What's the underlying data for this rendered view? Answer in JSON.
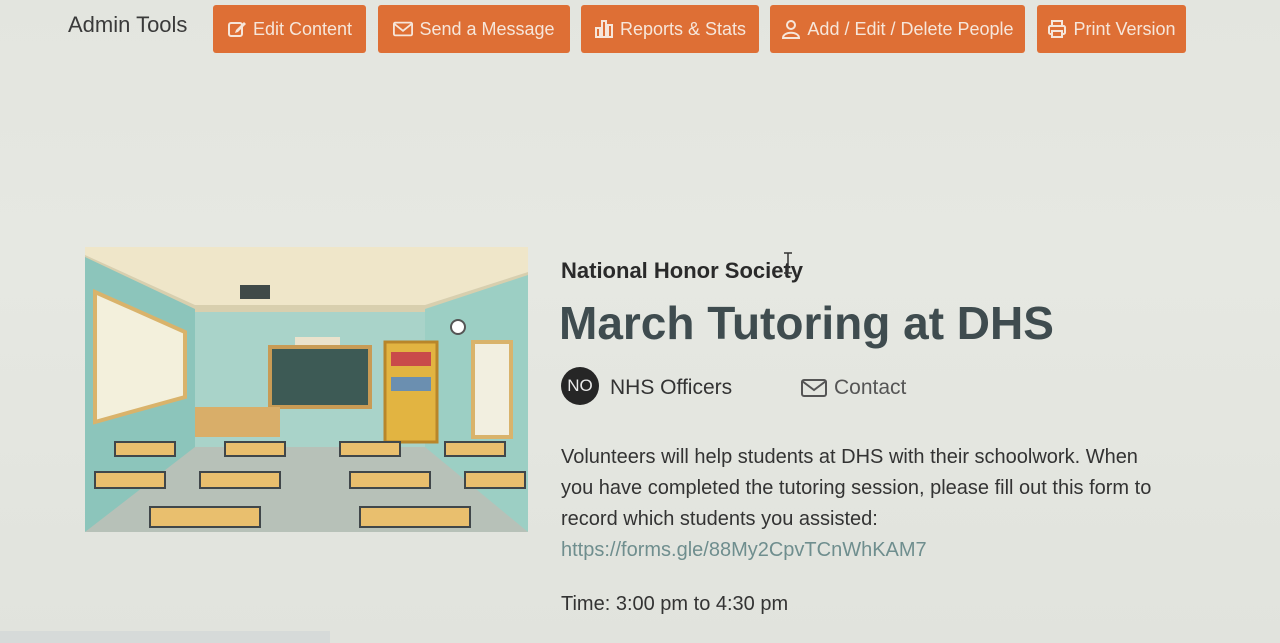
{
  "admin_bar": {
    "title": "Admin Tools",
    "buttons": [
      {
        "label": "Edit Content",
        "icon": "edit-icon"
      },
      {
        "label": "Send a Message",
        "icon": "envelope-icon"
      },
      {
        "label": "Reports & Stats",
        "icon": "bar-chart-icon"
      },
      {
        "label": "Add / Edit / Delete People",
        "icon": "person-icon"
      },
      {
        "label": "Print Version",
        "icon": "printer-icon"
      }
    ],
    "accent_color": "#de6f35"
  },
  "post": {
    "organization": "National Honor Society",
    "title": "March Tutoring at DHS",
    "author_initials": "NO",
    "author_name": "NHS Officers",
    "contact_label": "Contact",
    "description": "Volunteers will help students at DHS with their schoolwork. When you have completed the tutoring session, please fill out this form to record which students you assisted:",
    "form_link": "https://forms.gle/88My2CpvTCnWhKAM7",
    "time": "Time: 3:00 pm to 4:30 pm"
  }
}
